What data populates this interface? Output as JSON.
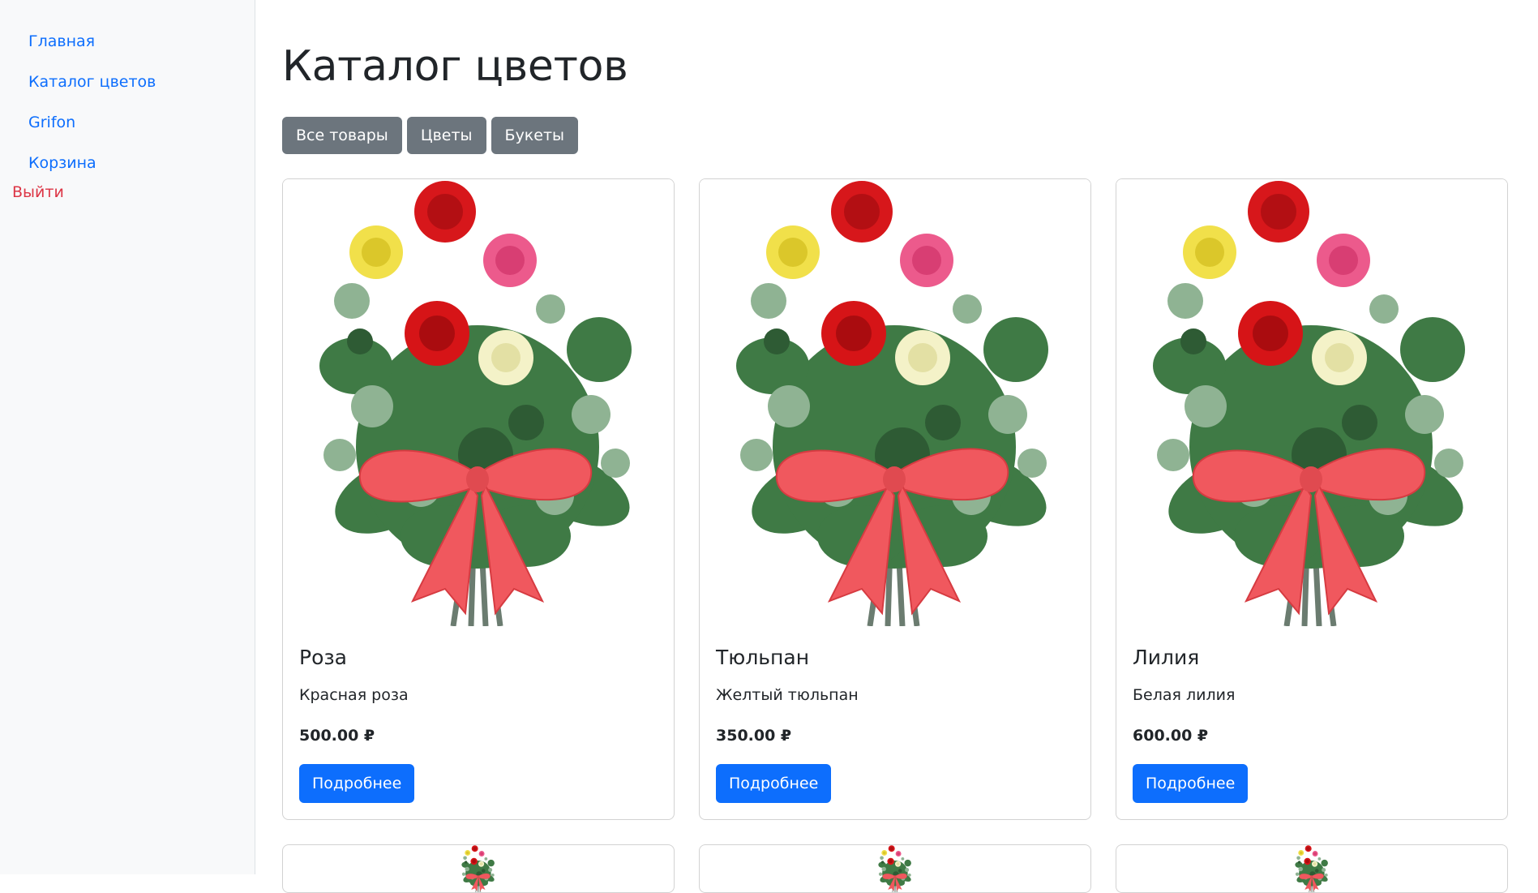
{
  "sidebar": {
    "nav": [
      {
        "label": "Главная"
      },
      {
        "label": "Каталог цветов"
      },
      {
        "label": "Grifon"
      },
      {
        "label": "Корзина"
      }
    ],
    "logout_label": "Выйти"
  },
  "main": {
    "title": "Каталог цветов",
    "filters": [
      {
        "label": "Все товары"
      },
      {
        "label": "Цветы"
      },
      {
        "label": "Букеты"
      }
    ],
    "products": [
      {
        "name": "Роза",
        "description": "Красная роза",
        "price": "500.00 ₽",
        "button": "Подробнее",
        "image_icon": "flower-bouquet-image"
      },
      {
        "name": "Тюльпан",
        "description": "Желтый тюльпан",
        "price": "350.00 ₽",
        "button": "Подробнее",
        "image_icon": "flower-bouquet-image"
      },
      {
        "name": "Лилия",
        "description": "Белая лилия",
        "price": "600.00 ₽",
        "button": "Подробнее",
        "image_icon": "flower-bouquet-image"
      }
    ]
  },
  "colors": {
    "primary": "#0d6efd",
    "secondary": "#6c757d",
    "danger": "#dc3545",
    "sidebar_bg": "#f8f9fa"
  }
}
